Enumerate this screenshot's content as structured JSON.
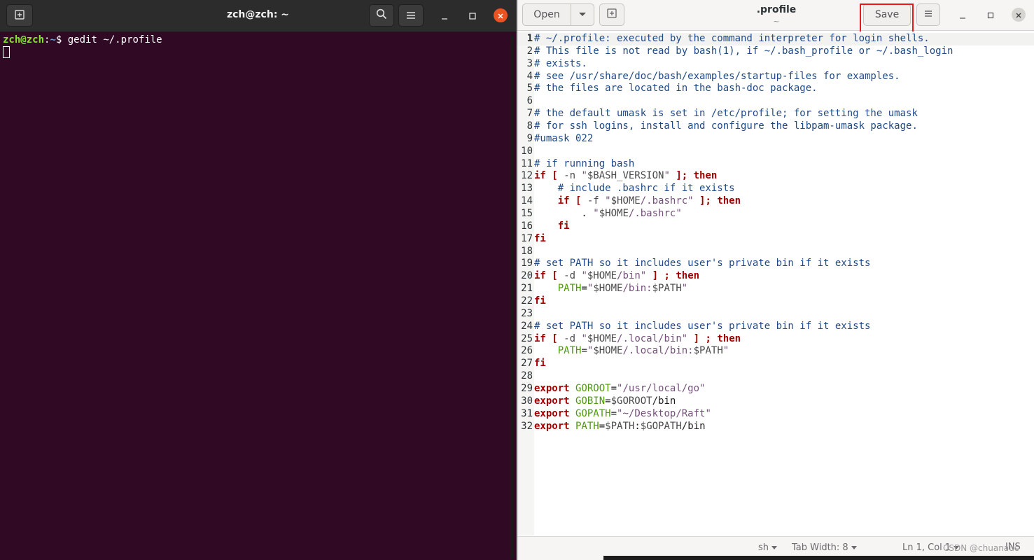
{
  "terminal": {
    "title": "zch@zch: ~",
    "prompt_user": "zch@zch",
    "prompt_sep": ":",
    "prompt_path": "~",
    "prompt_dollar": "$ ",
    "command": "gedit ~/.profile",
    "icons": {
      "new_tab": "new-tab-icon",
      "search": "search-icon",
      "menu": "hamburger-menu-icon",
      "minimize": "minimize-icon",
      "maximize": "maximize-icon",
      "close": "close-icon"
    },
    "close_color": "#e95420",
    "background": "#300a24"
  },
  "gedit": {
    "title": ".profile",
    "subtitle": "~",
    "open_label": "Open",
    "save_label": "Save",
    "statusbar": {
      "language": "sh",
      "tab_width": "Tab Width: 8",
      "position": "Ln 1, Col 1",
      "mode": "INS"
    },
    "highlight_color": "#e21b1b",
    "lines": [
      {
        "n": "1",
        "segs": [
          {
            "t": "# ~/.profile: executed by the command interpreter for login shells.",
            "c": "c"
          }
        ]
      },
      {
        "n": "2",
        "segs": [
          {
            "t": "# This file is not read by bash(1), if ~/.bash_profile or ~/.bash_login",
            "c": "c"
          }
        ]
      },
      {
        "n": "3",
        "segs": [
          {
            "t": "# exists.",
            "c": "c"
          }
        ]
      },
      {
        "n": "4",
        "segs": [
          {
            "t": "# see /usr/share/doc/bash/examples/startup-files for examples.",
            "c": "c"
          }
        ]
      },
      {
        "n": "5",
        "segs": [
          {
            "t": "# the files are located in the bash-doc package.",
            "c": "c"
          }
        ]
      },
      {
        "n": "6",
        "segs": []
      },
      {
        "n": "7",
        "segs": [
          {
            "t": "# the default umask is set in /etc/profile; for setting the umask",
            "c": "c"
          }
        ]
      },
      {
        "n": "8",
        "segs": [
          {
            "t": "# for ssh logins, install and configure the libpam-umask package.",
            "c": "c"
          }
        ]
      },
      {
        "n": "9",
        "segs": [
          {
            "t": "#umask 022",
            "c": "c"
          }
        ]
      },
      {
        "n": "10",
        "segs": []
      },
      {
        "n": "11",
        "segs": [
          {
            "t": "# if running bash",
            "c": "c"
          }
        ]
      },
      {
        "n": "12",
        "segs": [
          {
            "t": "if [",
            "c": "k"
          },
          {
            "t": " -n ",
            "c": "sv"
          },
          {
            "t": "\"",
            "c": "s"
          },
          {
            "t": "$BASH_VERSION",
            "c": "sv"
          },
          {
            "t": "\"",
            "c": "s"
          },
          {
            "t": " ]; then",
            "c": "k"
          }
        ]
      },
      {
        "n": "13",
        "segs": [
          {
            "t": "    # include .bashrc if it exists",
            "c": "c"
          }
        ]
      },
      {
        "n": "14",
        "segs": [
          {
            "t": "    if [",
            "c": "k"
          },
          {
            "t": " -f ",
            "c": "sv"
          },
          {
            "t": "\"",
            "c": "s"
          },
          {
            "t": "$HOME",
            "c": "sv"
          },
          {
            "t": "/.bashrc\"",
            "c": "s"
          },
          {
            "t": " ]; then",
            "c": "k"
          }
        ]
      },
      {
        "n": "15",
        "segs": [
          {
            "t": "        . ",
            "c": "t"
          },
          {
            "t": "\"",
            "c": "s"
          },
          {
            "t": "$HOME",
            "c": "sv"
          },
          {
            "t": "/.bashrc\"",
            "c": "s"
          }
        ]
      },
      {
        "n": "16",
        "segs": [
          {
            "t": "    fi",
            "c": "k"
          }
        ]
      },
      {
        "n": "17",
        "segs": [
          {
            "t": "fi",
            "c": "k"
          }
        ]
      },
      {
        "n": "18",
        "segs": []
      },
      {
        "n": "19",
        "segs": [
          {
            "t": "# set PATH so it includes user's private bin if it exists",
            "c": "c"
          }
        ]
      },
      {
        "n": "20",
        "segs": [
          {
            "t": "if [",
            "c": "k"
          },
          {
            "t": " -d ",
            "c": "sv"
          },
          {
            "t": "\"",
            "c": "s"
          },
          {
            "t": "$HOME",
            "c": "sv"
          },
          {
            "t": "/bin\"",
            "c": "s"
          },
          {
            "t": " ] ; then",
            "c": "k"
          }
        ]
      },
      {
        "n": "21",
        "segs": [
          {
            "t": "    PATH",
            "c": "var"
          },
          {
            "t": "=",
            "c": "t"
          },
          {
            "t": "\"",
            "c": "s"
          },
          {
            "t": "$HOME",
            "c": "sv"
          },
          {
            "t": "/bin:",
            "c": "s"
          },
          {
            "t": "$PATH",
            "c": "sv"
          },
          {
            "t": "\"",
            "c": "s"
          }
        ]
      },
      {
        "n": "22",
        "segs": [
          {
            "t": "fi",
            "c": "k"
          }
        ]
      },
      {
        "n": "23",
        "segs": []
      },
      {
        "n": "24",
        "segs": [
          {
            "t": "# set PATH so it includes user's private bin if it exists",
            "c": "c"
          }
        ]
      },
      {
        "n": "25",
        "segs": [
          {
            "t": "if [",
            "c": "k"
          },
          {
            "t": " -d ",
            "c": "sv"
          },
          {
            "t": "\"",
            "c": "s"
          },
          {
            "t": "$HOME",
            "c": "sv"
          },
          {
            "t": "/.local/bin\"",
            "c": "s"
          },
          {
            "t": " ] ; then",
            "c": "k"
          }
        ]
      },
      {
        "n": "26",
        "segs": [
          {
            "t": "    PATH",
            "c": "var"
          },
          {
            "t": "=",
            "c": "t"
          },
          {
            "t": "\"",
            "c": "s"
          },
          {
            "t": "$HOME",
            "c": "sv"
          },
          {
            "t": "/.local/bin:",
            "c": "s"
          },
          {
            "t": "$PATH",
            "c": "sv"
          },
          {
            "t": "\"",
            "c": "s"
          }
        ]
      },
      {
        "n": "27",
        "segs": [
          {
            "t": "fi",
            "c": "k"
          }
        ]
      },
      {
        "n": "28",
        "segs": []
      },
      {
        "n": "29",
        "segs": [
          {
            "t": "export",
            "c": "k"
          },
          {
            "t": " GOROOT",
            "c": "var"
          },
          {
            "t": "=",
            "c": "t"
          },
          {
            "t": "\"/usr/local/go\"",
            "c": "s"
          }
        ]
      },
      {
        "n": "30",
        "segs": [
          {
            "t": "export",
            "c": "k"
          },
          {
            "t": " GOBIN",
            "c": "var"
          },
          {
            "t": "=",
            "c": "t"
          },
          {
            "t": "$GOROOT",
            "c": "sv"
          },
          {
            "t": "/bin",
            "c": "t"
          }
        ]
      },
      {
        "n": "31",
        "segs": [
          {
            "t": "export",
            "c": "k"
          },
          {
            "t": " GOPATH",
            "c": "var"
          },
          {
            "t": "=",
            "c": "t"
          },
          {
            "t": "\"~/Desktop/Raft\"",
            "c": "s"
          }
        ]
      },
      {
        "n": "32",
        "segs": [
          {
            "t": "export",
            "c": "k"
          },
          {
            "t": " PATH",
            "c": "var"
          },
          {
            "t": "=",
            "c": "t"
          },
          {
            "t": "$PATH",
            "c": "sv"
          },
          {
            "t": ":",
            "c": "t"
          },
          {
            "t": "$GOPATH",
            "c": "sv"
          },
          {
            "t": "/bin",
            "c": "t"
          }
        ]
      }
    ]
  },
  "watermark": "CSDN @chuanauc"
}
